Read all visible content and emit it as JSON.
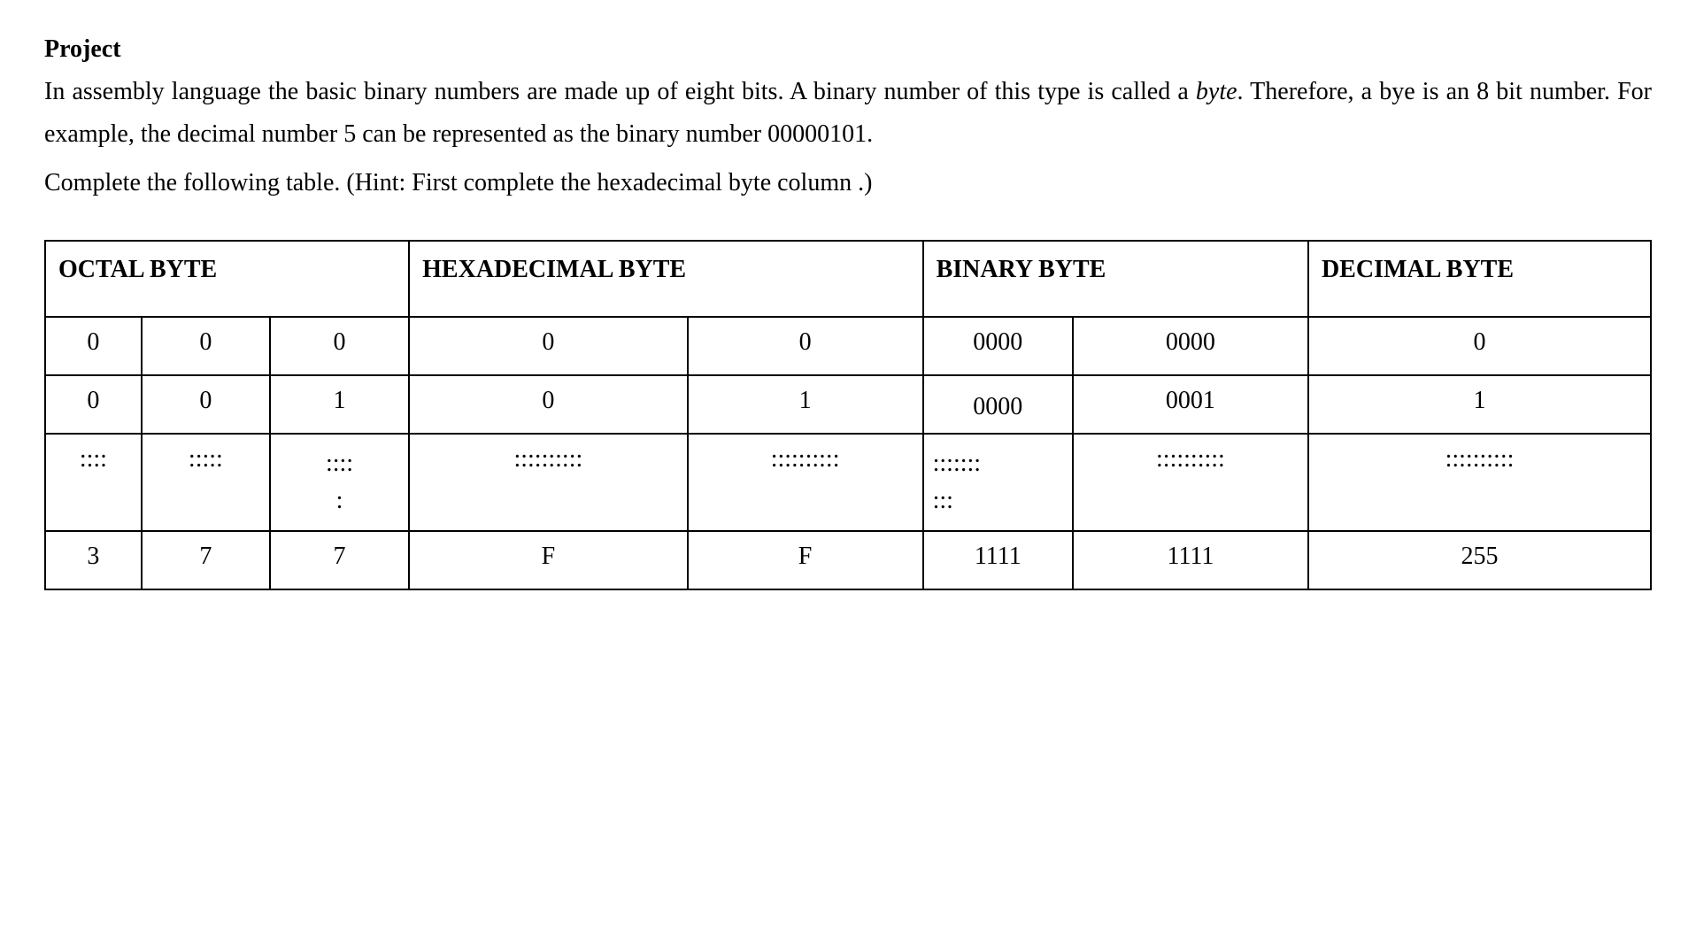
{
  "heading": "Project",
  "para1_a": "In assembly language the basic binary numbers are made up of eight bits. A binary number of this type is called a ",
  "para1_italic": "byte",
  "para1_b": ". Therefore, a bye is an 8 bit number. For example, the decimal number 5 can be represented as the binary number 00000101.",
  "para2": "Complete the following table. (Hint: First complete the hexadecimal byte column .)",
  "headers": {
    "octal": "OCTAL BYTE",
    "hex": "HEXADECIMAL BYTE",
    "binary": "BINARY BYTE",
    "decimal": "DECIMAL  BYTE"
  },
  "rows": [
    {
      "oct1": "0",
      "oct2": "0",
      "oct3": "0",
      "hex1": "0",
      "hex2": "0",
      "bin1": "0000",
      "bin2": "0000",
      "dec": "0"
    },
    {
      "oct1": "0",
      "oct2": "0",
      "oct3": "1",
      "hex1": "0",
      "hex2": "1",
      "bin1": "0000",
      "bin2": "0001",
      "dec": "1"
    },
    {
      "oct1": "::::",
      "oct2": ":::::",
      "oct3": "::::\n:",
      "hex1": "::::::::::",
      "hex2": "::::::::::",
      "bin1": ":::::::\n:::",
      "bin2": "::::::::::",
      "dec": "::::::::::"
    },
    {
      "oct1": "3",
      "oct2": "7",
      "oct3": "7",
      "hex1": "F",
      "hex2": "F",
      "bin1": "1111",
      "bin2": "1111",
      "dec": "255"
    }
  ]
}
